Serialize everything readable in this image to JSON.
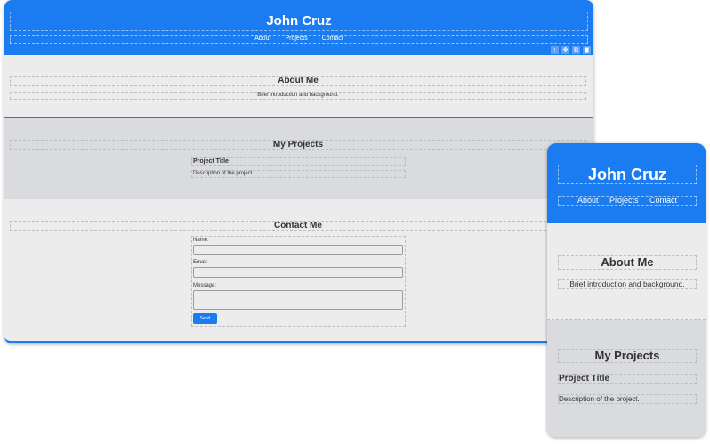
{
  "site": {
    "name": "John Cruz",
    "nav": [
      "About",
      "Projects",
      "Contact"
    ]
  },
  "toolbar": [
    "↑",
    "✥",
    "⧉",
    "🗑"
  ],
  "about": {
    "heading": "About Me",
    "text": "Brief introduction and background."
  },
  "projects": {
    "heading": "My Projects",
    "card_title": "Project Title",
    "card_desc": "Description of the project."
  },
  "contact": {
    "heading": "Contact Me",
    "name_label": "Name:",
    "email_label": "Email:",
    "message_label": "Message:",
    "send_label": "Send"
  },
  "colors": {
    "accent": "#1a7cf0",
    "section_light": "#ececec",
    "section_dark": "#d9dbde"
  }
}
